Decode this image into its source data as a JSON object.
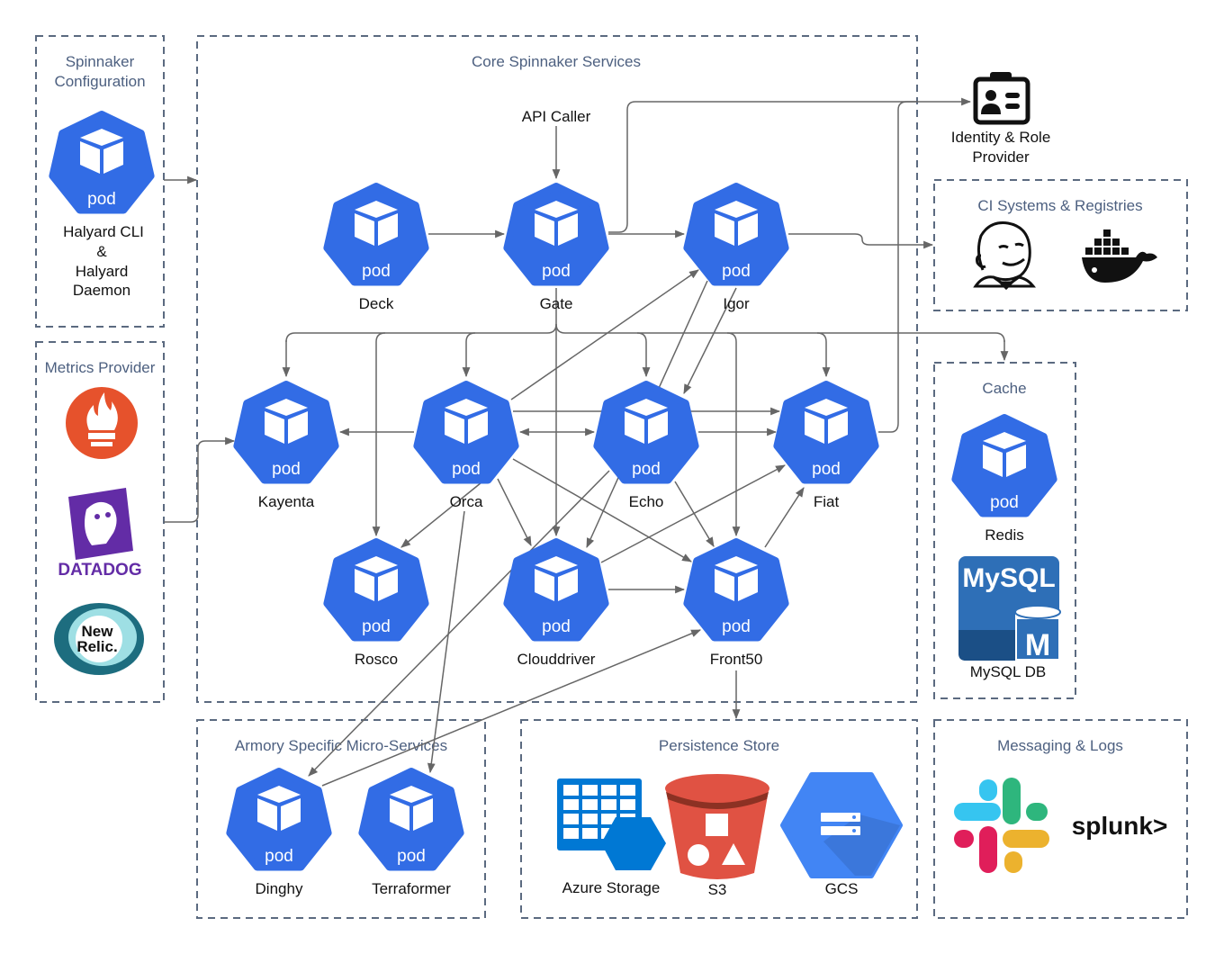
{
  "colors": {
    "pod": "#326ce5",
    "group_border": "#5b6a80",
    "group_title": "#4d6080",
    "edge": "#666666"
  },
  "pod_badge": "pod",
  "groups": {
    "config": {
      "title_line1": "Spinnaker",
      "title_line2": "Configuration"
    },
    "metrics": {
      "title": "Metrics Provider"
    },
    "core": {
      "title": "Core Spinnaker Services"
    },
    "ci": {
      "title": "CI Systems & Registries"
    },
    "cache": {
      "title": "Cache"
    },
    "armory": {
      "title": "Armory Specific Micro-Services"
    },
    "persistence": {
      "title": "Persistence Store"
    },
    "messaging": {
      "title": "Messaging & Logs"
    }
  },
  "halyard": {
    "line1": "Halyard CLI",
    "line2": "&",
    "line3": "Halyard",
    "line4": "Daemon"
  },
  "api_caller": "API Caller",
  "identity": {
    "line1": "Identity & Role",
    "line2": "Provider",
    "icon": "id-badge-icon"
  },
  "services": [
    "Deck",
    "Gate",
    "Igor",
    "Kayenta",
    "Orca",
    "Echo",
    "Fiat",
    "Rosco",
    "Clouddriver",
    "Front50",
    "Dinghy",
    "Terraformer",
    "Redis"
  ],
  "metrics_logos": {
    "prometheus": "prometheus-logo",
    "datadog": "DATADOG",
    "newrelic_line1": "New",
    "newrelic_line2": "Relic."
  },
  "ci_logos": [
    "jenkins-logo",
    "docker-logo"
  ],
  "mysql": {
    "logo_text": "MySQL",
    "badge": "M",
    "label": "MySQL DB"
  },
  "persistence": {
    "azure": "Azure Storage",
    "s3": "S3",
    "gcs": "GCS"
  },
  "messaging_logos": {
    "slack": "slack-logo",
    "splunk": "splunk>"
  }
}
